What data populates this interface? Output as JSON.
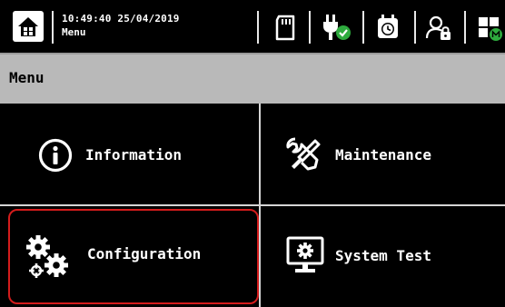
{
  "header": {
    "datetime": "10:49:40 25/04/2019",
    "subtitle": "Menu",
    "icons": [
      "home-icon",
      "sd-card-icon",
      "power-plug-ok-icon",
      "calendar-clock-icon",
      "user-lock-icon",
      "dashboard-icon"
    ],
    "ok_color": "#2eab3e"
  },
  "titlebar": {
    "title": "Menu"
  },
  "menu": {
    "items": [
      {
        "label": "Information",
        "icon": "info-icon"
      },
      {
        "label": "Maintenance",
        "icon": "tools-icon"
      },
      {
        "label": "Configuration",
        "icon": "gears-icon",
        "selected": true
      },
      {
        "label": "System Test",
        "icon": "monitor-gear-icon"
      }
    ],
    "selection_color": "#d41c1c"
  }
}
